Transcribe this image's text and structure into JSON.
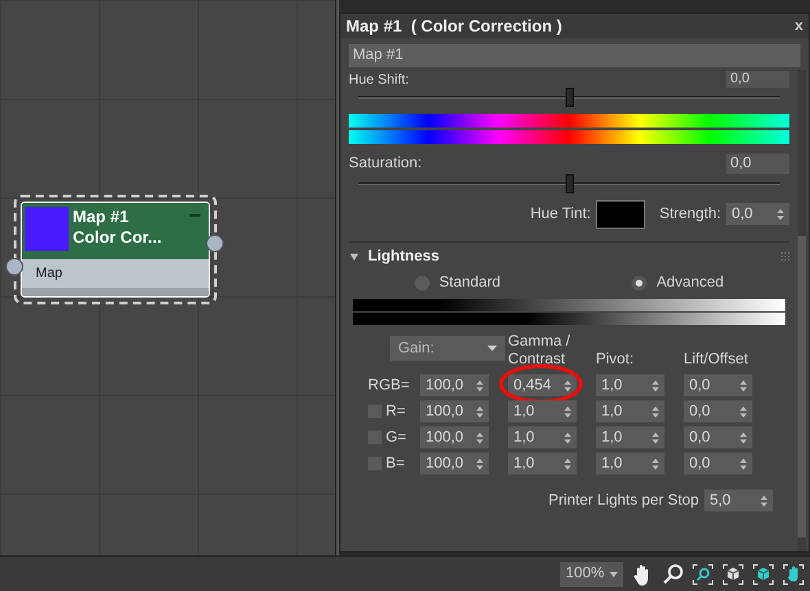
{
  "node": {
    "title": "Map #1",
    "subtitle": "Color Cor...",
    "port_label": "Map"
  },
  "panel": {
    "title": "Map #1  ( Color Correction )",
    "close": "x",
    "name_field": "Map #1"
  },
  "color": {
    "hue_shift": {
      "label": "Hue Shift:",
      "value": "0,0",
      "level": 0.5
    },
    "saturation": {
      "label": "Saturation:",
      "value": "0,0",
      "level": 0.5
    },
    "hue_tint_label": "Hue Tint:",
    "strength_label": "Strength:",
    "strength": "0,0"
  },
  "lightness": {
    "title": "Lightness",
    "expanded": true,
    "modes": [
      {
        "label": "Standard",
        "selected": false
      },
      {
        "label": "Advanced",
        "selected": true
      }
    ],
    "columns": [
      {
        "kind": "dropdown",
        "text": "Gain:"
      },
      {
        "kind": "header",
        "text": "Gamma / Contrast"
      },
      {
        "kind": "header",
        "text": "Pivot:"
      },
      {
        "kind": "header",
        "text": "Lift/Offset"
      }
    ],
    "rows": [
      {
        "label": "RGB=",
        "kind": "plain",
        "cells": [
          {
            "text": "100,0",
            "circled": false
          },
          {
            "text": "0,454",
            "circled": true
          },
          {
            "text": "1,0",
            "circled": false
          },
          {
            "text": "0,0",
            "circled": false
          }
        ]
      },
      {
        "label": "R=",
        "kind": "checkbox",
        "checked": false,
        "cells": [
          {
            "text": "100,0",
            "circled": false
          },
          {
            "text": "1,0",
            "circled": false
          },
          {
            "text": "1,0",
            "circled": false
          },
          {
            "text": "0,0",
            "circled": false
          }
        ]
      },
      {
        "label": "G=",
        "kind": "checkbox",
        "checked": false,
        "cells": [
          {
            "text": "100,0",
            "circled": false
          },
          {
            "text": "1,0",
            "circled": false
          },
          {
            "text": "1,0",
            "circled": false
          },
          {
            "text": "0,0",
            "circled": false
          }
        ]
      },
      {
        "label": "B=",
        "kind": "checkbox",
        "checked": false,
        "cells": [
          {
            "text": "100,0",
            "circled": false
          },
          {
            "text": "1,0",
            "circled": false
          },
          {
            "text": "1,0",
            "circled": false
          },
          {
            "text": "0,0",
            "circled": false
          }
        ]
      }
    ],
    "printer_label": "Printer Lights per Stop",
    "printer_value": "5,0"
  },
  "toolbar": {
    "zoom": "100%"
  }
}
